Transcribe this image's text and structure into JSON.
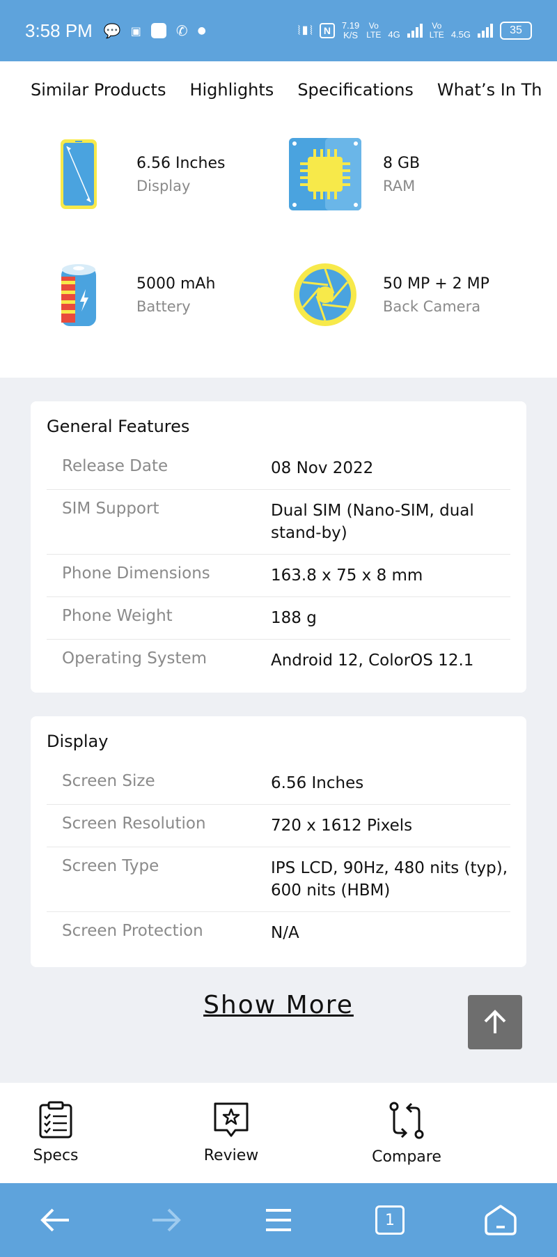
{
  "status_bar": {
    "time": "3:58 PM",
    "speed_value": "7.19",
    "speed_unit": "K/S",
    "sim1_top": "Vo",
    "sim1_bottom": "LTE",
    "sim1_gen": "4G",
    "sim2_top": "Vo",
    "sim2_bottom": "LTE",
    "sim2_gen": "4.5G",
    "battery": "35"
  },
  "tabs": [
    "Similar Products",
    "Highlights",
    "Specifications",
    "What’s In Th"
  ],
  "highlights": [
    {
      "value": "6.56 Inches",
      "label": "Display",
      "icon": "phone-display-icon"
    },
    {
      "value": "8 GB",
      "label": "RAM",
      "icon": "ram-chip-icon"
    },
    {
      "value": "5000 mAh",
      "label": "Battery",
      "icon": "battery-icon"
    },
    {
      "value": "50 MP + 2 MP",
      "label": "Back Camera",
      "icon": "camera-aperture-icon"
    }
  ],
  "general_features": {
    "title": "General Features",
    "rows": [
      {
        "key": "Release Date",
        "value": "08 Nov 2022"
      },
      {
        "key": "SIM Support",
        "value": "Dual SIM (Nano-SIM, dual stand-by)"
      },
      {
        "key": "Phone Dimensions",
        "value": "163.8 x 75 x 8 mm"
      },
      {
        "key": "Phone Weight",
        "value": "188 g"
      },
      {
        "key": "Operating System",
        "value": "Android 12, ColorOS 12.1"
      }
    ]
  },
  "display": {
    "title": "Display",
    "rows": [
      {
        "key": "Screen Size",
        "value": "6.56 Inches"
      },
      {
        "key": "Screen Resolution",
        "value": "720 x 1612 Pixels"
      },
      {
        "key": "Screen Type",
        "value": "IPS LCD, 90Hz, 480 nits (typ), 600 nits (HBM)"
      },
      {
        "key": "Screen Protection",
        "value": "N/A"
      }
    ]
  },
  "show_more": "Show More",
  "bottom_tabs": [
    {
      "label": "Specs",
      "icon": "clipboard-checklist-icon"
    },
    {
      "label": "Review",
      "icon": "star-message-icon"
    },
    {
      "label": "Compare",
      "icon": "compare-arrows-icon"
    }
  ],
  "browser": {
    "tab_count": "1"
  },
  "colors": {
    "bar_blue": "#5ea3dc",
    "accent_yellow": "#f7e94a",
    "icon_blue": "#4aa3df"
  }
}
